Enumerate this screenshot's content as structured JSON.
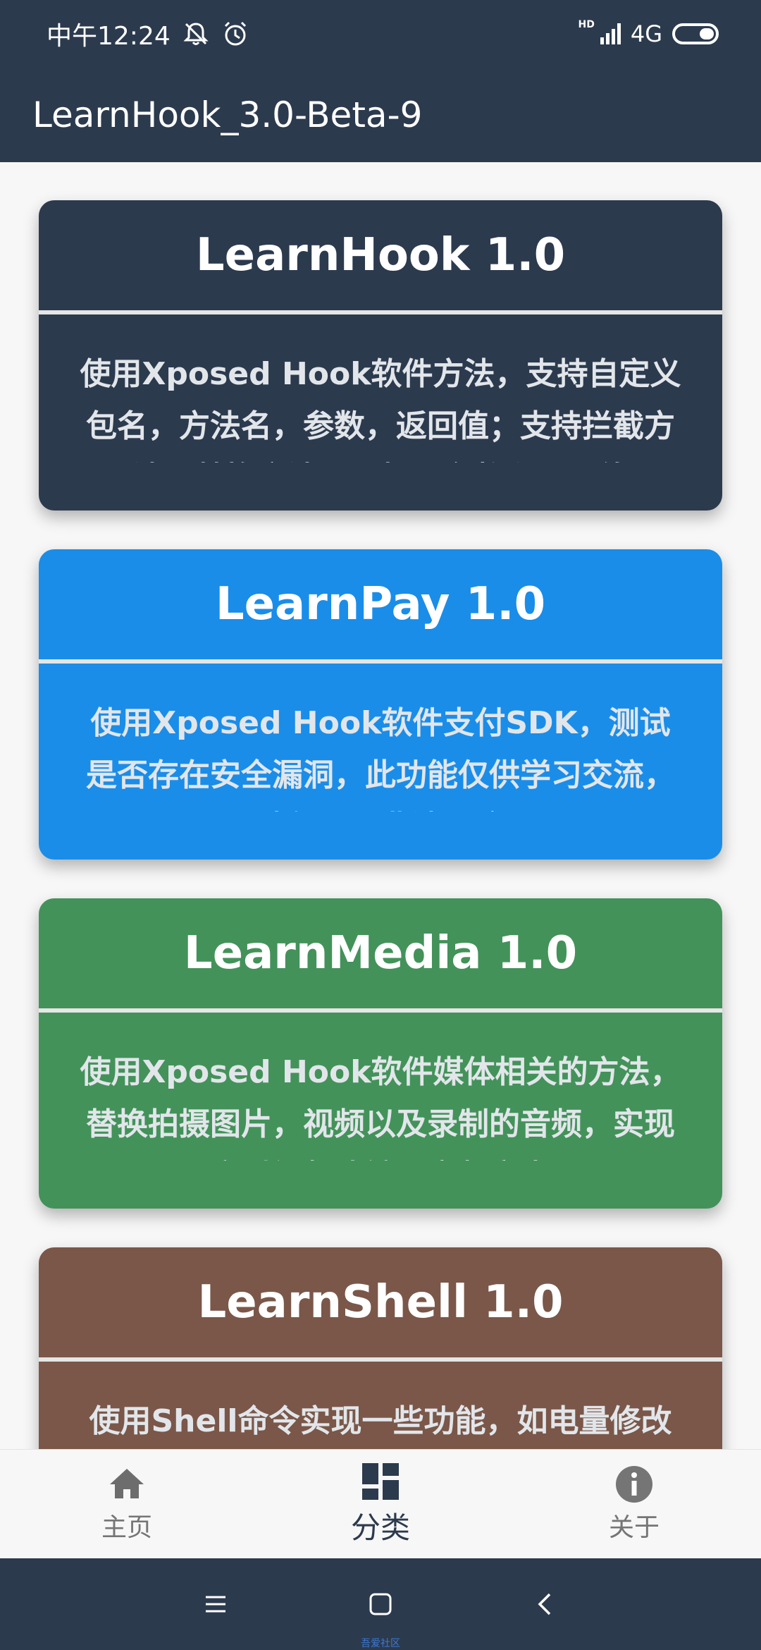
{
  "status_bar": {
    "time": "中午12:24",
    "network": "4G"
  },
  "app_bar": {
    "title": "LearnHook_3.0-Beta-9"
  },
  "cards": [
    {
      "title": "LearnHook 1.0",
      "description": "使用Xposed Hook软件方法，支持自定义包名，方法名，参数，返回值；支持拦截方法，替换方法以及打印参数和返回值",
      "color": "#2c3a4e"
    },
    {
      "title": "LearnPay 1.0",
      "description": "使用Xposed Hook软件支付SDK，测试是否存在安全漏洞，此功能仅供学习交流，请勿用于非法用途",
      "color": "#1a8de9"
    },
    {
      "title": "LearnMedia 1.0",
      "description": "使用Xposed Hook软件媒体相关的方法，替换拍摄图片，视频以及录制的音频，实现实时视频滤镜，音频变声",
      "color": "#43925a"
    },
    {
      "title": "LearnShell 1.0",
      "description": "使用Shell命令实现一些功能，如电量修改等",
      "color": "#7a5749"
    }
  ],
  "bottom_nav": {
    "items": [
      {
        "label": "主页",
        "icon": "home-icon",
        "active": false
      },
      {
        "label": "分类",
        "icon": "dashboard-icon",
        "active": true
      },
      {
        "label": "关于",
        "icon": "info-icon",
        "active": false
      }
    ]
  },
  "watermark": "吾爱社区",
  "colors": {
    "primary_dark": "#2c3a4e",
    "background": "#f7f7f7",
    "nav_inactive": "#757575"
  }
}
